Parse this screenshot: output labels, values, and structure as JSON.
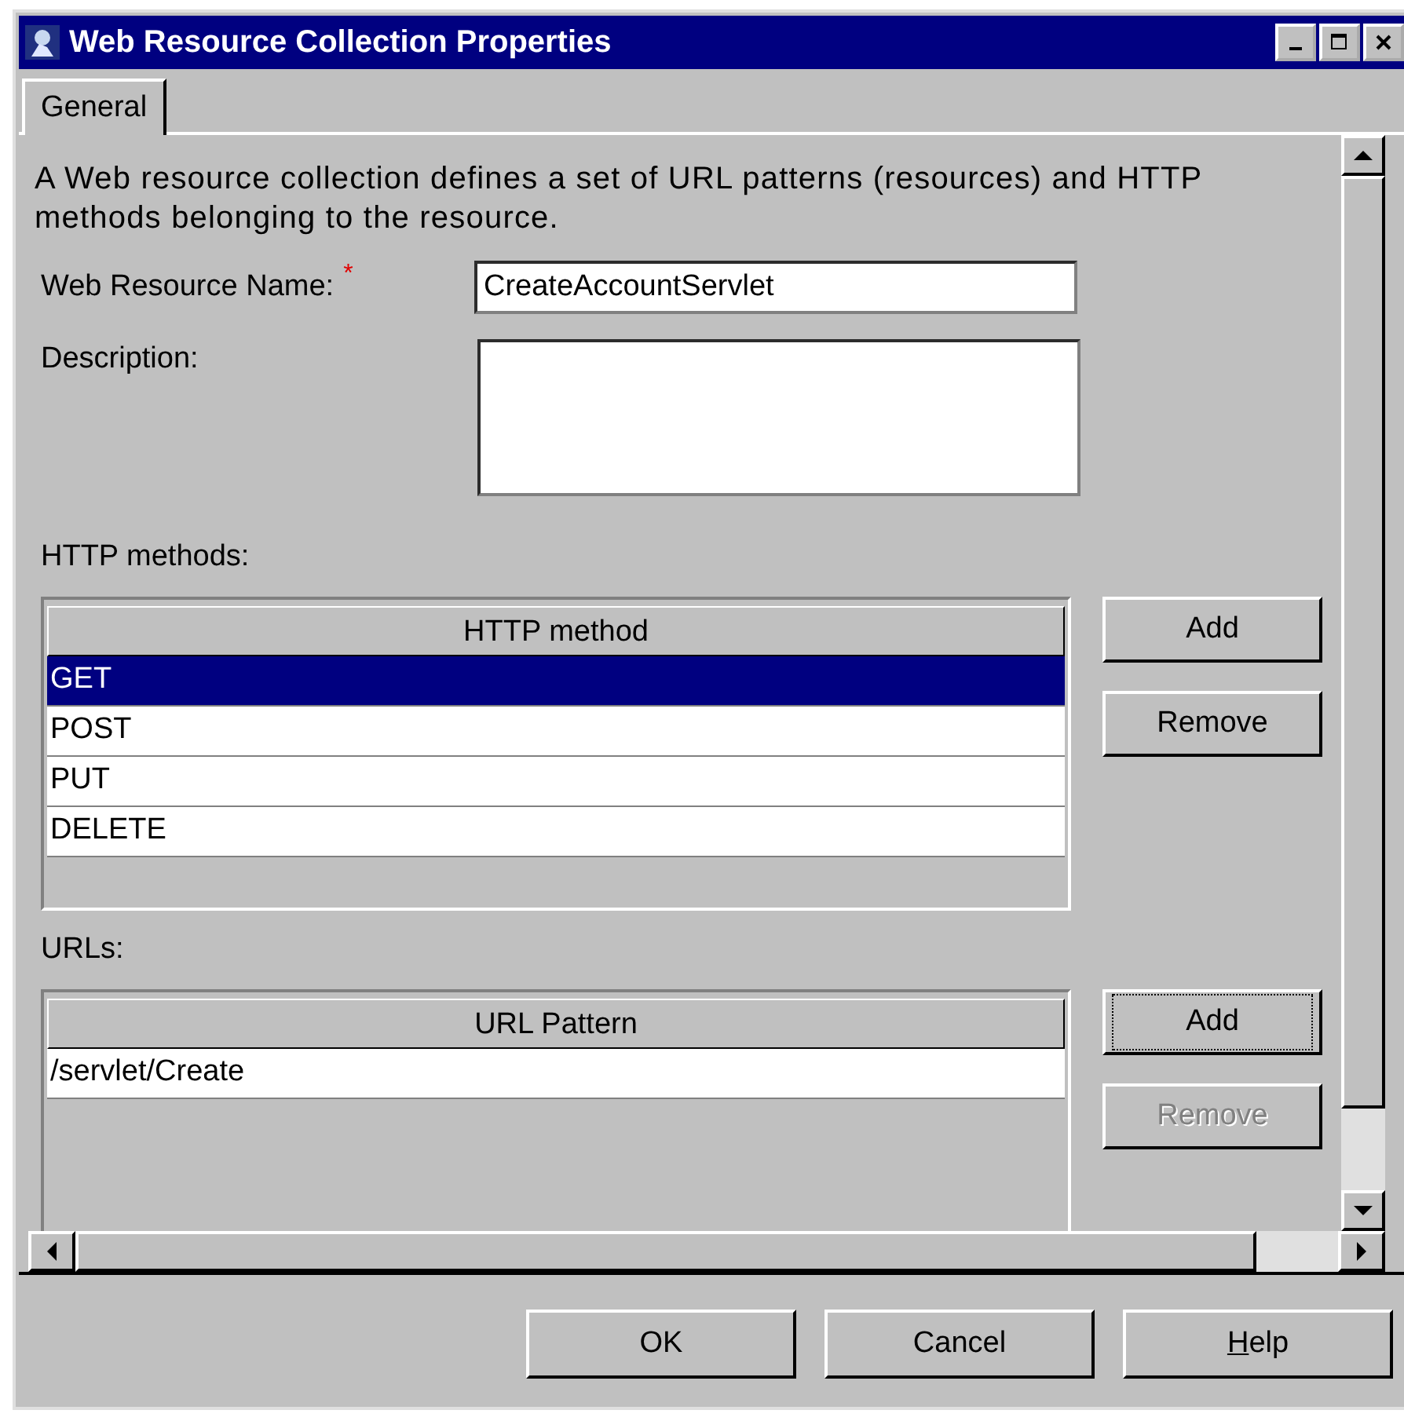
{
  "window": {
    "title": "Web Resource Collection Properties"
  },
  "tabs": [
    {
      "label": "General",
      "selected": true
    }
  ],
  "intro": "A Web resource collection defines a set of URL patterns (resources) and HTTP methods belonging to the resource.",
  "fields": [
    {
      "label": "Web Resource Name:",
      "required": true,
      "value": "CreateAccountServlet",
      "kind": "line"
    },
    {
      "label": "Description:",
      "required": false,
      "kind": "area"
    }
  ],
  "sections": [
    {
      "label": "HTTP methods:",
      "column": "HTTP method",
      "rows": [
        {
          "text": "GET",
          "selected": true
        },
        {
          "text": "POST",
          "selected": false
        },
        {
          "text": "PUT",
          "selected": false
        },
        {
          "text": "DELETE",
          "selected": false
        }
      ],
      "buttons": [
        {
          "label": "Add",
          "disabled": false,
          "focused": false
        },
        {
          "label": "Remove",
          "disabled": false,
          "focused": false
        }
      ]
    },
    {
      "label": "URLs:",
      "column": "URL Pattern",
      "rows": [
        {
          "text": "/servlet/Create",
          "selected": false
        }
      ],
      "buttons": [
        {
          "label": "Add",
          "disabled": false,
          "focused": true
        },
        {
          "label": "Remove",
          "disabled": true,
          "focused": false
        }
      ]
    }
  ],
  "required_mark": "*",
  "dialog_buttons": [
    {
      "label": "OK",
      "first_letter_underlined": false
    },
    {
      "label": "Cancel",
      "first_letter_underlined": false
    },
    {
      "label": "Help",
      "first_letter_underlined": true
    }
  ]
}
